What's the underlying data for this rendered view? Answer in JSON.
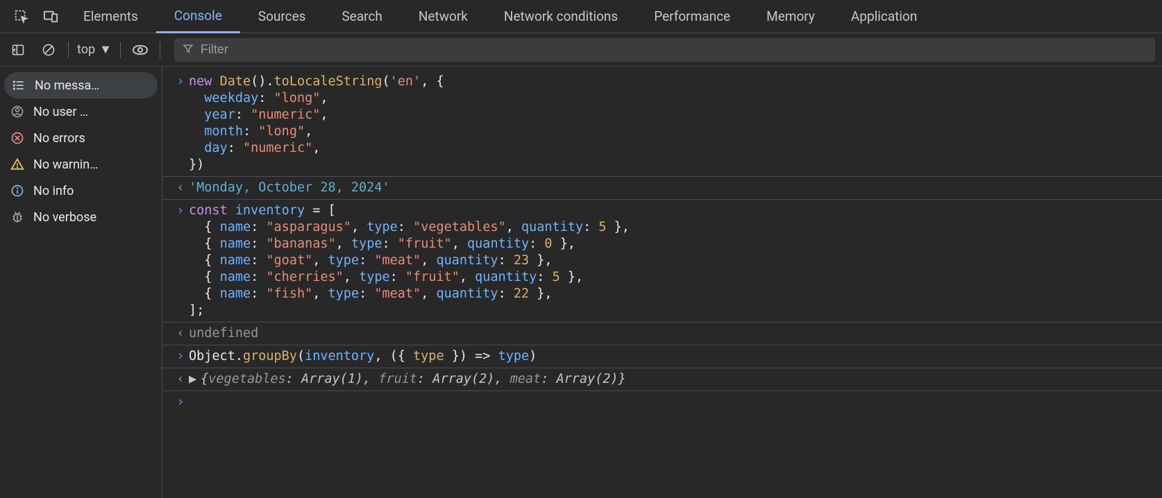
{
  "tabs": {
    "elements": "Elements",
    "console": "Console",
    "sources": "Sources",
    "search": "Search",
    "network": "Network",
    "network_conditions": "Network conditions",
    "performance": "Performance",
    "memory": "Memory",
    "application": "Application"
  },
  "toolbar": {
    "context": "top",
    "filter_placeholder": "Filter"
  },
  "sidebar": {
    "no_messages": "No messa…",
    "no_user": "No user …",
    "no_errors": "No errors",
    "no_warnings": "No warnin…",
    "no_info": "No info",
    "no_verbose": "No verbose"
  },
  "console_entries": {
    "input1_line1": "new Date().toLocaleString('en', {",
    "input1_line2": "  weekday: \"long\",",
    "input1_line3": "  year: \"numeric\",",
    "input1_line4": "  month: \"long\",",
    "input1_line5": "  day: \"numeric\",",
    "input1_line6": "})",
    "output1": "'Monday, October 28, 2024'",
    "input2_line1": "const inventory = [",
    "input2_line2": "  { name: \"asparagus\", type: \"vegetables\", quantity: 5 },",
    "input2_line3": "  { name: \"bananas\", type: \"fruit\", quantity: 0 },",
    "input2_line4": "  { name: \"goat\", type: \"meat\", quantity: 23 },",
    "input2_line5": "  { name: \"cherries\", type: \"fruit\", quantity: 5 },",
    "input2_line6": "  { name: \"fish\", type: \"meat\", quantity: 22 },",
    "input2_line7": "];",
    "output2": "undefined",
    "input3": "Object.groupBy(inventory, ({ type }) => type)",
    "output3_pre": "{",
    "output3_k1": "vegetables",
    "output3_v1": ": Array(1), ",
    "output3_k2": "fruit",
    "output3_v2": ": Array(2), ",
    "output3_k3": "meat",
    "output3_v3": ": Array(2)",
    "output3_post": "}"
  }
}
